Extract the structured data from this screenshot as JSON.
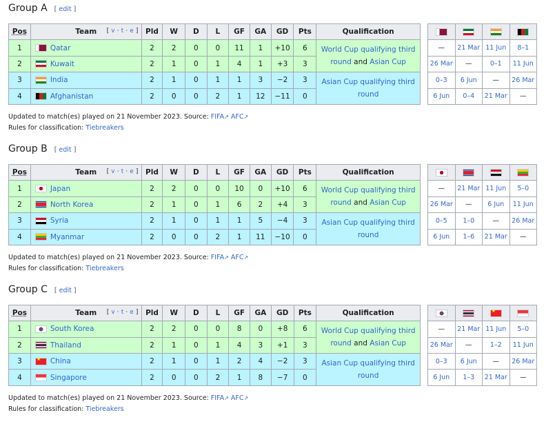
{
  "labels": {
    "edit": "edit",
    "updated_prefix": "Updated to match(es) played on 21 November 2023. Source:",
    "source_fifa": "FIFA",
    "source_afc": "AFC",
    "rules_prefix": "Rules for classification:",
    "tiebreakers": "Tiebreakers",
    "ext_icon": "↗",
    "vte_v": "v",
    "vte_t": "t",
    "vte_e": "e",
    "qual_part1": "World Cup qualifying third round",
    "qual_and": "and",
    "qual_asian_cup": "Asian Cup",
    "qual_asian_only": "Asian Cup qualifying third round"
  },
  "columns": [
    "Pos",
    "Team",
    "Pld",
    "W",
    "D",
    "L",
    "GF",
    "GA",
    "GD",
    "Pts",
    "Qualification"
  ],
  "colors": {
    "promotion_green": "#ccffcc",
    "asian_cup_blue": "#bbf3ff",
    "header_gray": "#eaecf0",
    "link": "#3366cc"
  },
  "groups": [
    {
      "title": "Group A",
      "teams": [
        {
          "pos": "1",
          "name": "Qatar",
          "flag": "qatar-flag-icon",
          "pld": "2",
          "w": "2",
          "d": "0",
          "l": "0",
          "gf": "11",
          "ga": "1",
          "gd": "+10",
          "pts": "6"
        },
        {
          "pos": "2",
          "name": "Kuwait",
          "flag": "kuwait-flag-icon",
          "pld": "2",
          "w": "1",
          "d": "0",
          "l": "1",
          "gf": "4",
          "ga": "1",
          "gd": "+3",
          "pts": "3"
        },
        {
          "pos": "3",
          "name": "India",
          "flag": "india-flag-icon",
          "pld": "2",
          "w": "1",
          "d": "0",
          "l": "1",
          "gf": "1",
          "ga": "3",
          "gd": "−2",
          "pts": "3"
        },
        {
          "pos": "4",
          "name": "Afghanistan",
          "flag": "afghanistan-flag-icon",
          "pld": "2",
          "w": "0",
          "d": "0",
          "l": "2",
          "gf": "1",
          "ga": "12",
          "gd": "−11",
          "pts": "0"
        }
      ],
      "results": [
        [
          "—",
          "21 Mar",
          "11 Jun",
          "8–1"
        ],
        [
          "26 Mar",
          "—",
          "0–1",
          "11 Jun"
        ],
        [
          "0–3",
          "6 Jun",
          "—",
          "26 Mar"
        ],
        [
          "6 Jun",
          "0–4",
          "21 Mar",
          "—"
        ]
      ]
    },
    {
      "title": "Group B",
      "teams": [
        {
          "pos": "1",
          "name": "Japan",
          "flag": "japan-flag-icon",
          "pld": "2",
          "w": "2",
          "d": "0",
          "l": "0",
          "gf": "10",
          "ga": "0",
          "gd": "+10",
          "pts": "6"
        },
        {
          "pos": "2",
          "name": "North Korea",
          "flag": "north-korea-flag-icon",
          "pld": "2",
          "w": "1",
          "d": "0",
          "l": "1",
          "gf": "6",
          "ga": "2",
          "gd": "+4",
          "pts": "3"
        },
        {
          "pos": "3",
          "name": "Syria",
          "flag": "syria-flag-icon",
          "pld": "2",
          "w": "1",
          "d": "0",
          "l": "1",
          "gf": "1",
          "ga": "5",
          "gd": "−4",
          "pts": "3"
        },
        {
          "pos": "4",
          "name": "Myanmar",
          "flag": "myanmar-flag-icon",
          "pld": "2",
          "w": "0",
          "d": "0",
          "l": "2",
          "gf": "1",
          "ga": "11",
          "gd": "−10",
          "pts": "0"
        }
      ],
      "results": [
        [
          "—",
          "21 Mar",
          "11 Jun",
          "5–0"
        ],
        [
          "26 Mar",
          "—",
          "6 Jun",
          "11 Jun"
        ],
        [
          "0–5",
          "1–0",
          "—",
          "26 Mar"
        ],
        [
          "6 Jun",
          "1–6",
          "21 Mar",
          "—"
        ]
      ]
    },
    {
      "title": "Group C",
      "teams": [
        {
          "pos": "1",
          "name": "South Korea",
          "flag": "south-korea-flag-icon",
          "pld": "2",
          "w": "2",
          "d": "0",
          "l": "0",
          "gf": "8",
          "ga": "0",
          "gd": "+8",
          "pts": "6"
        },
        {
          "pos": "2",
          "name": "Thailand",
          "flag": "thailand-flag-icon",
          "pld": "2",
          "w": "1",
          "d": "0",
          "l": "1",
          "gf": "4",
          "ga": "3",
          "gd": "+1",
          "pts": "3"
        },
        {
          "pos": "3",
          "name": "China",
          "flag": "china-flag-icon",
          "pld": "2",
          "w": "1",
          "d": "0",
          "l": "1",
          "gf": "2",
          "ga": "4",
          "gd": "−2",
          "pts": "3"
        },
        {
          "pos": "4",
          "name": "Singapore",
          "flag": "singapore-flag-icon",
          "pld": "2",
          "w": "0",
          "d": "0",
          "l": "2",
          "gf": "1",
          "ga": "8",
          "gd": "−7",
          "pts": "0"
        }
      ],
      "results": [
        [
          "—",
          "21 Mar",
          "11 Jun",
          "5–0"
        ],
        [
          "26 Mar",
          "—",
          "1–2",
          "11 Jun"
        ],
        [
          "0–3",
          "6 Jun",
          "—",
          "26 Mar"
        ],
        [
          "6 Jun",
          "1–3",
          "21 Mar",
          "—"
        ]
      ]
    }
  ]
}
